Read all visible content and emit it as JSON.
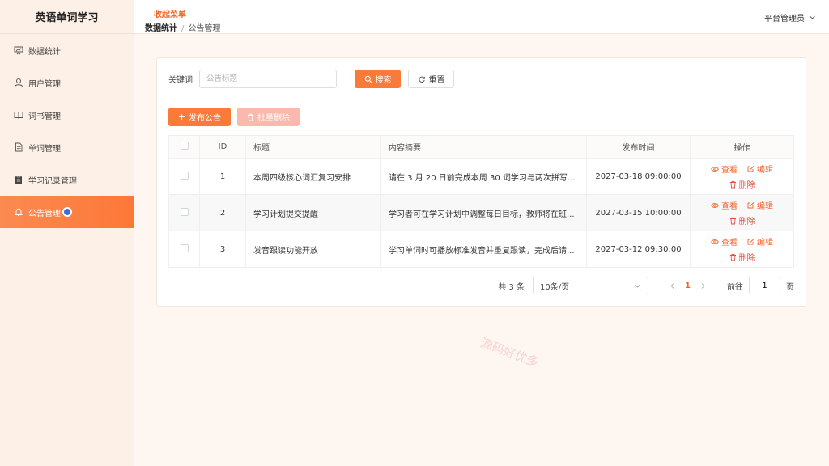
{
  "app": {
    "title": "英语单词学习"
  },
  "sidebar": {
    "items": [
      {
        "label": "数据统计",
        "icon": "chart-board-icon"
      },
      {
        "label": "用户管理",
        "icon": "user-icon"
      },
      {
        "label": "词书管理",
        "icon": "book-icon"
      },
      {
        "label": "单词管理",
        "icon": "document-icon"
      },
      {
        "label": "学习记录管理",
        "icon": "clipboard-icon"
      },
      {
        "label": "公告管理",
        "icon": "bell-icon",
        "active": true
      }
    ]
  },
  "header": {
    "collapse_label": "收起菜单",
    "breadcrumb": {
      "home": "数据统计",
      "separator": "/",
      "current": "公告管理"
    },
    "user_label": "平台管理员"
  },
  "filter": {
    "keyword_label": "关键词",
    "keyword_placeholder": "公告标题",
    "keyword_value": "",
    "search_label": "搜索",
    "reset_label": "重置"
  },
  "actions": {
    "publish_label": "发布公告",
    "batch_delete_label": "批量删除"
  },
  "table": {
    "columns": {
      "id": "ID",
      "title": "标题",
      "summary": "内容摘要",
      "time": "发布时间",
      "ops": "操作"
    },
    "op_labels": {
      "view": "查看",
      "edit": "编辑",
      "delete": "删除"
    },
    "rows": [
      {
        "id": "1",
        "title": "本周四级核心词汇复习安排",
        "summary": "请在 3 月 20 日前完成本周 30 词学习与两次拼写...",
        "time": "2027-03-18 09:00:00"
      },
      {
        "id": "2",
        "title": "学习计划提交提醒",
        "summary": "学习者可在学习计划中调整每日目标，教师将在班...",
        "time": "2027-03-15 10:00:00"
      },
      {
        "id": "3",
        "title": "发音跟读功能开放",
        "summary": "学习单词时可播放标准发音并重复跟读，完成后请...",
        "time": "2027-03-12 09:30:00"
      }
    ]
  },
  "pagination": {
    "total_text": "共 3 条",
    "page_size": "10条/页",
    "current_page": "1",
    "goto_label": "前往",
    "goto_value": "1",
    "page_suffix": "页"
  },
  "watermark": "源码好优多",
  "colors": {
    "accent": "#fa7a3a",
    "danger": "#e34d3e",
    "sidebar_bg": "#fdf0e6"
  }
}
